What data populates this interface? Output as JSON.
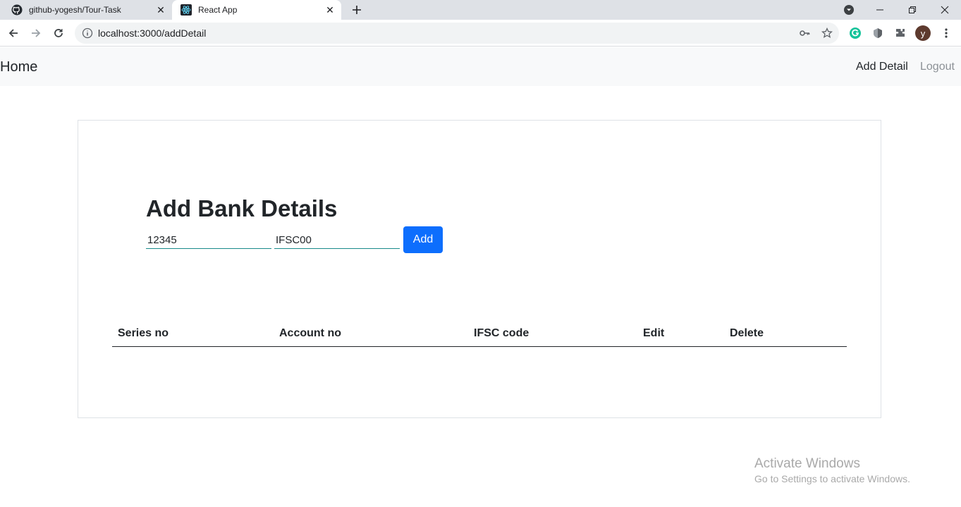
{
  "browser": {
    "tabs": [
      {
        "title": "github-yogesh/Tour-Task",
        "icon": "github-icon",
        "active": false
      },
      {
        "title": "React App",
        "icon": "react-icon",
        "active": true
      }
    ],
    "url": "localhost:3000/addDetail",
    "profile_initial": "y"
  },
  "navbar": {
    "brand": "Home",
    "links": [
      {
        "label": "Add Detail"
      },
      {
        "label": "Logout"
      }
    ]
  },
  "form": {
    "title": "Add Bank Details",
    "account_value": "12345",
    "ifsc_value": "IFSC00",
    "add_label": "Add"
  },
  "table": {
    "columns": [
      "Series no",
      "Account no",
      "IFSC code",
      "Edit",
      "Delete"
    ],
    "rows": []
  },
  "watermark": {
    "line1": "Activate Windows",
    "line2": "Go to Settings to activate Windows."
  },
  "colors": {
    "accent": "#0d6efd",
    "input_underline": "#198b8a",
    "navbar_bg": "#f8f9fa"
  }
}
